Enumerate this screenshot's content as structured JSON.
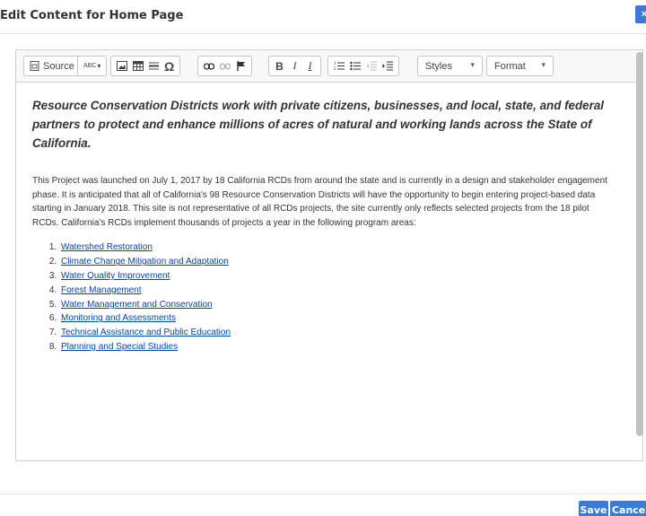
{
  "dialog": {
    "title": "Edit Content for Home Page",
    "close_label": "×"
  },
  "toolbar": {
    "source_label": "Source",
    "spellcheck_label": "ABC",
    "styles_label": "Styles",
    "format_label": "Format",
    "special_char_label": "Ω",
    "bold_label": "B",
    "italic_label": "I",
    "remove_format_label": "I"
  },
  "content": {
    "lead": "Resource Conservation Districts work with private citizens, businesses, and local, state, and federal partners to protect and enhance millions of acres of natural and working lands across the State of California.",
    "paragraph": "This Project was launched on July 1, 2017 by 18 California RCDs from around the state and is currently in a design and stakeholder engagement phase. It is anticipated that all of California's 98 Resource Conservation Districts will have the opportunity to begin entering project-based data starting in January 2018. This site is not representative of all RCDs projects, the site currently only reflects selected projects from the 18 pilot RCDs. California's RCDs implement thousands of projects a year in the following program areas:",
    "programs": [
      "Watershed Restoration",
      "Climate Change Mitigation and Adaptation",
      "Water Quality Improvement",
      "Forest Management",
      "Water Management and Conservation",
      "Monitoring and Assessments",
      "Technical Assistance and Public Education",
      "Planning and Special Studies"
    ]
  },
  "footer": {
    "save_label": "Save",
    "cancel_label": "Cancel"
  },
  "colors": {
    "accent": "#3a7bd5",
    "link": "#0645ad"
  }
}
